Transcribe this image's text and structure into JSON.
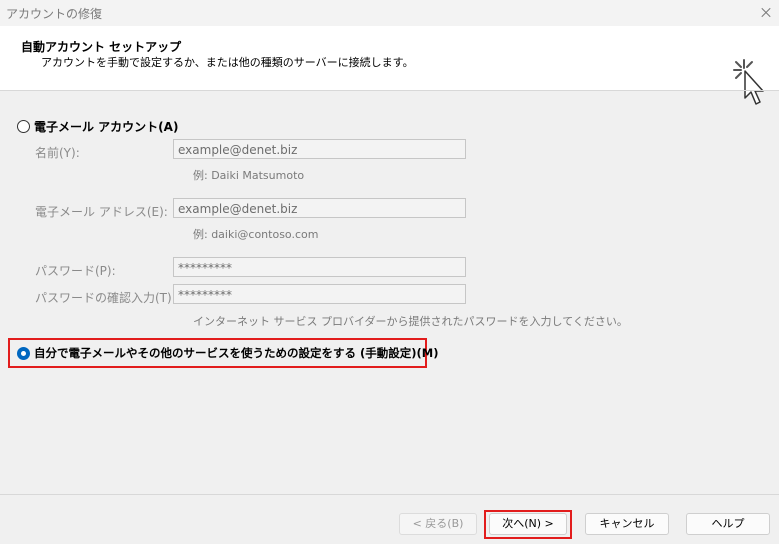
{
  "window": {
    "title": "アカウントの修復"
  },
  "header": {
    "title": "自動アカウント セットアップ",
    "description": "アカウントを手動で設定するか、または他の種類のサーバーに接続します。"
  },
  "email_option": {
    "label": "電子メール アカウント(A)",
    "selected": false,
    "name": {
      "label": "名前(Y):",
      "value": "example@denet.biz",
      "hint": "例: Daiki Matsumoto"
    },
    "email": {
      "label": "電子メール アドレス(E):",
      "value": "example@denet.biz",
      "hint": "例: daiki@contoso.com"
    },
    "password": {
      "label": "パスワード(P):",
      "value": "*********"
    },
    "password_confirm": {
      "label": "パスワードの確認入力(T):",
      "value": "*********"
    },
    "password_hint": "インターネット サービス プロバイダーから提供されたパスワードを入力してください。"
  },
  "manual_option": {
    "label": "自分で電子メールやその他のサービスを使うための設定をする (手動設定)(M)",
    "selected": true
  },
  "buttons": {
    "back": "< 戻る(B)",
    "next": "次へ(N) >",
    "cancel": "キャンセル",
    "help": "ヘルプ"
  },
  "colors": {
    "highlight": "#e21c1c",
    "accent": "#0067c0"
  }
}
